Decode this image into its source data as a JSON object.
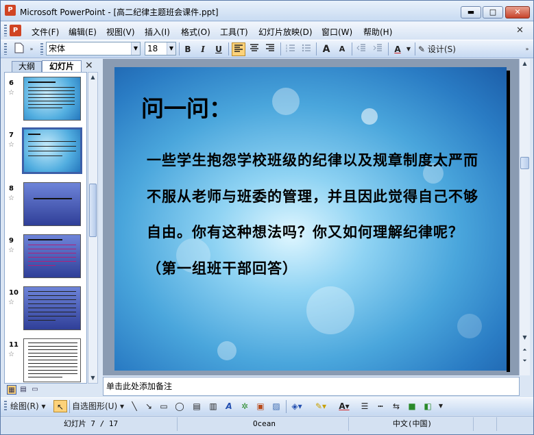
{
  "window": {
    "title": "Microsoft PowerPoint - [高二纪律主题班会课件.ppt]",
    "app_icon_letter": "P",
    "min_glyph": "▬",
    "max_glyph": "□",
    "close_glyph": "✕"
  },
  "menu": {
    "items": [
      "文件(F)",
      "编辑(E)",
      "视图(V)",
      "插入(I)",
      "格式(O)",
      "工具(T)",
      "幻灯片放映(D)",
      "窗口(W)",
      "帮助(H)"
    ],
    "close_glyph": "✕"
  },
  "toolbar": {
    "font_name": "宋体",
    "font_size": "18",
    "bold": "B",
    "italic": "I",
    "underline": "U",
    "grow_font": "A",
    "shrink_font": "A",
    "font_color": "A",
    "design_label": "设计(S)"
  },
  "left_pane": {
    "tabs": [
      "大纲",
      "幻灯片"
    ],
    "close_glyph": "✕",
    "thumbnails": [
      {
        "number": "6",
        "style": "ice"
      },
      {
        "number": "7",
        "style": "ice",
        "selected": true
      },
      {
        "number": "8",
        "style": "blue"
      },
      {
        "number": "9",
        "style": "blue"
      },
      {
        "number": "10",
        "style": "blue"
      },
      {
        "number": "11",
        "style": "paper"
      }
    ],
    "star_glyph": "☆"
  },
  "slide": {
    "title": "问一问：",
    "body": "一些学生抱怨学校班级的纪律以及规章制度太严而不服从老师与班委的管理，并且因此觉得自己不够自由。你有这种想法吗？你又如何理解纪律呢？（第一组班干部回答）"
  },
  "notes": {
    "placeholder": "单击此处添加备注"
  },
  "drawing_toolbar": {
    "draw_label": "绘图(R)",
    "autoshape_label": "自选图形(U)"
  },
  "status": {
    "slide_info": "幻灯片 7 / 17",
    "theme": "Ocean",
    "language": "中文(中国)"
  },
  "colors": {
    "title_bar": "#c8dbf2",
    "accent": "#3d5fa8",
    "close_red": "#c7432b",
    "slide_blue": "#4aa6dc"
  }
}
